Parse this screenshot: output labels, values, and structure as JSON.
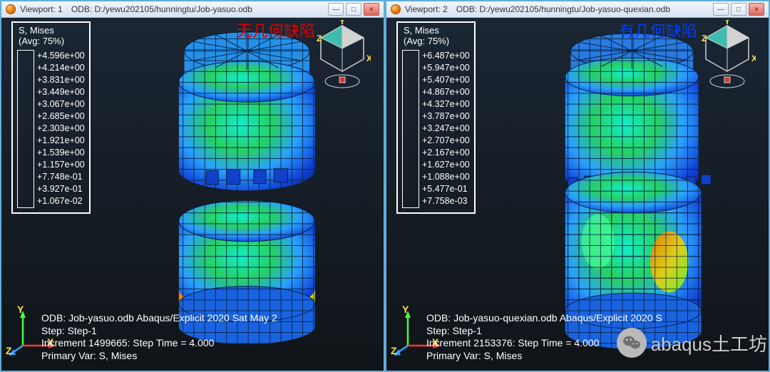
{
  "viewports": [
    {
      "title_label": "Viewport: 1",
      "odb_label": "ODB: D:/yewu202105/hunningtu/Job-yasuo.odb",
      "annotation": {
        "text": "无几何缺陷",
        "color": "red"
      },
      "legend": {
        "title": "S, Mises\n(Avg: 75%)",
        "ticks": [
          "+4.596e+00",
          "+4.214e+00",
          "+3.831e+00",
          "+3.449e+00",
          "+3.067e+00",
          "+2.685e+00",
          "+2.303e+00",
          "+1.921e+00",
          "+1.539e+00",
          "+1.157e+00",
          "+7.748e-01",
          "+3.927e-01",
          "+1.067e-02"
        ]
      },
      "footer": {
        "l1": "ODB: Job-yasuo.odb    Abaqus/Explicit 2020    Sat May 2",
        "l2": "Step: Step-1",
        "l3": "Increment   1499665: Step Time =    4.000",
        "l4": "Primary Var: S, Mises"
      }
    },
    {
      "title_label": "Viewport: 2",
      "odb_label": "ODB: D:/yewu202105/hunningtu/Job-yasuo-quexian.odb",
      "annotation": {
        "text": "有几何缺陷",
        "color": "blue"
      },
      "legend": {
        "title": "S, Mises\n(Avg: 75%)",
        "ticks": [
          "+6.487e+00",
          "+5.947e+00",
          "+5.407e+00",
          "+4.867e+00",
          "+4.327e+00",
          "+3.787e+00",
          "+3.247e+00",
          "+2.707e+00",
          "+2.167e+00",
          "+1.627e+00",
          "+1.088e+00",
          "+5.477e-01",
          "+7.758e-03"
        ]
      },
      "footer": {
        "l1": "ODB: Job-yasuo-quexian.odb    Abaqus/Explicit 2020    S",
        "l2": "Step: Step-1",
        "l3": "Increment   2153376: Step Time =    4.000",
        "l4": "Primary Var: S, Mises"
      }
    }
  ],
  "colorbar_colors": [
    "#cc0000",
    "#ff3300",
    "#ff7a00",
    "#ffb300",
    "#ffe600",
    "#b7ff00",
    "#5cff00",
    "#00ff66",
    "#00ffcc",
    "#00ccff",
    "#0066ff",
    "#0000cc"
  ],
  "window_buttons": {
    "min": "—",
    "max": "□",
    "close": "×"
  },
  "axes": {
    "x": "X",
    "y": "Y",
    "z": "Z"
  },
  "watermark": {
    "text": "abaqus土工坊"
  }
}
